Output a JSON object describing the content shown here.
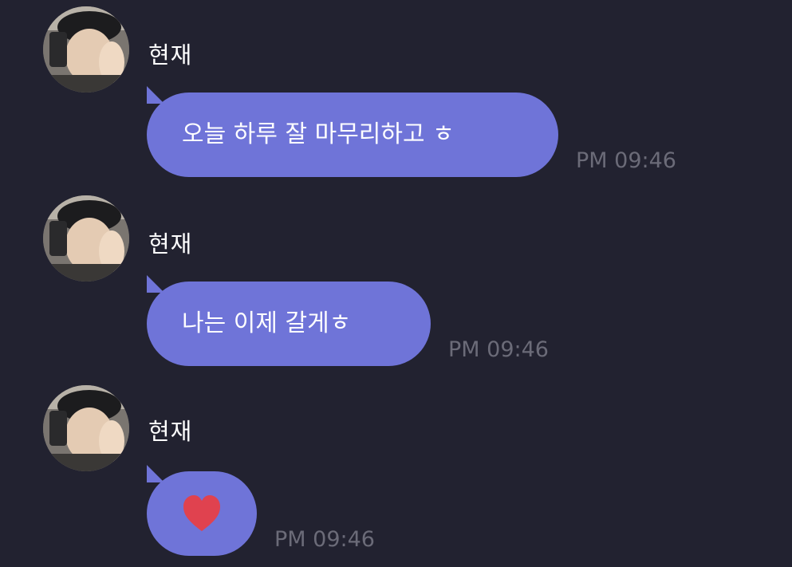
{
  "theme": {
    "background": "#222230",
    "bubble_color": "#6f74d8",
    "timestamp_color": "#6b6b78",
    "heart_color": "#e0424f"
  },
  "messages": [
    {
      "sender": "현재",
      "avatar_icon": "profile-photo",
      "text": "오늘 하루 잘 마무리하고 ㅎ",
      "time": "PM 09:46"
    },
    {
      "sender": "현재",
      "avatar_icon": "profile-photo",
      "text": "나는 이제 갈게ㅎ",
      "time": "PM 09:46"
    },
    {
      "sender": "현재",
      "avatar_icon": "profile-photo",
      "emoji": "heart-icon",
      "time": "PM 09:46"
    }
  ]
}
